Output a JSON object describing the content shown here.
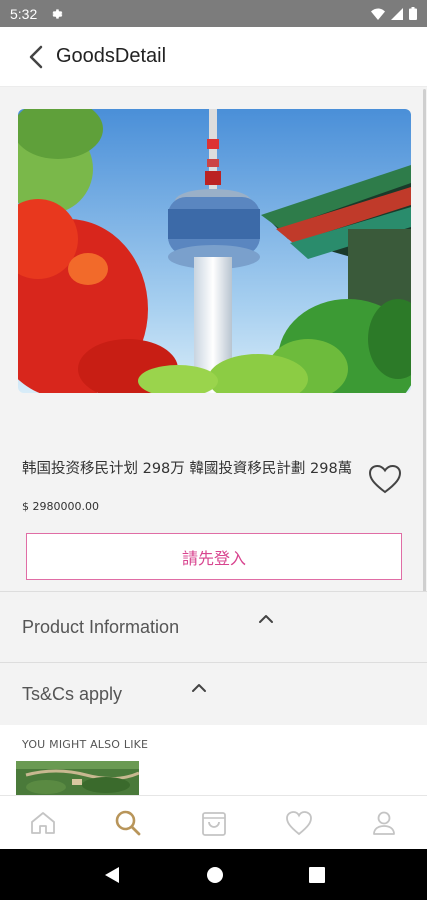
{
  "status_bar": {
    "time": "5:32"
  },
  "appbar": {
    "title": "GoodsDetail"
  },
  "product": {
    "name": "韩国投资移民计划 298万  韓國投資移民計劃 298萬",
    "price": "$ 2980000.00",
    "login_label": "請先登入"
  },
  "sections": {
    "product_info": "Product Information",
    "terms": "Ts&Cs apply"
  },
  "recommendations": {
    "heading": "YOU MIGHT ALSO LIKE"
  },
  "bottom_nav": [
    "home-icon",
    "search-icon",
    "cart-icon",
    "heart-icon",
    "user-icon"
  ],
  "colors": {
    "accent": "#d8448f",
    "nav_active": "#b8955a",
    "nav_inactive": "#c4c4c4"
  }
}
